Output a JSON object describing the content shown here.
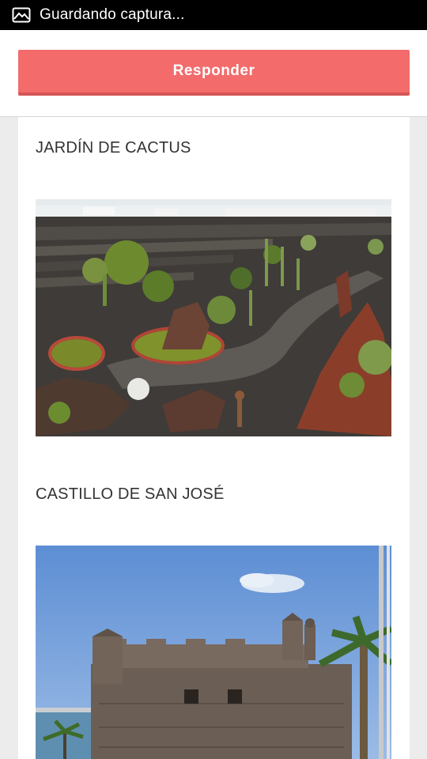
{
  "status_bar": {
    "icon": "image-icon",
    "text": "Guardando captura..."
  },
  "header": {
    "reply_label": "Responder",
    "accent_color": "#f36b6b"
  },
  "sections": [
    {
      "title": "JARDÍN DE CACTUS",
      "image": "cactus-garden-photo"
    },
    {
      "title": "CASTILLO DE SAN JOSÉ",
      "image": "castle-photo"
    }
  ]
}
